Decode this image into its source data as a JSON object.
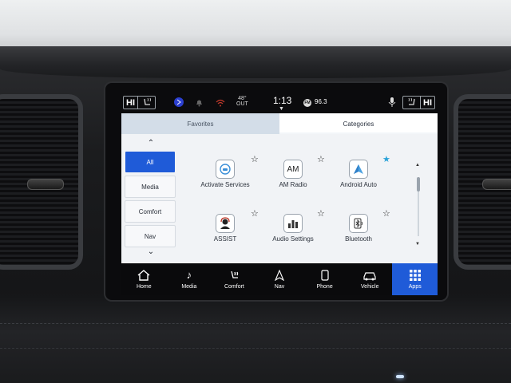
{
  "status_bar": {
    "driver_temp": "HI",
    "passenger_temp": "HI",
    "outside_temp": "48°",
    "outside_label": "OUT",
    "time": "1:13",
    "radio_band": "FM",
    "radio_frequency": "96.3",
    "icons": [
      "heated-seat-icon",
      "sync-icon",
      "bell-icon",
      "wifi-icon",
      "microphone-icon"
    ]
  },
  "tabs": [
    {
      "label": "Favorites",
      "active": false
    },
    {
      "label": "Categories",
      "active": true
    }
  ],
  "categories": [
    {
      "label": "All",
      "selected": true
    },
    {
      "label": "Media",
      "selected": false
    },
    {
      "label": "Comfort",
      "selected": false
    },
    {
      "label": "Nav",
      "selected": false
    }
  ],
  "apps": [
    {
      "label": "Activate Services",
      "icon": "car-service-icon",
      "favorite": false
    },
    {
      "label": "AM Radio",
      "icon": "am-radio-icon",
      "icon_text": "AM",
      "favorite": false
    },
    {
      "label": "Android Auto",
      "icon": "android-auto-icon",
      "favorite": true
    },
    {
      "label": "ASSIST",
      "icon": "assist-icon",
      "favorite": false
    },
    {
      "label": "Audio Settings",
      "icon": "audio-settings-icon",
      "favorite": false
    },
    {
      "label": "Bluetooth",
      "icon": "bluetooth-icon",
      "favorite": false
    }
  ],
  "bottom_nav": [
    {
      "label": "Home",
      "icon": "home-icon",
      "active": false
    },
    {
      "label": "Media",
      "icon": "music-note-icon",
      "active": false
    },
    {
      "label": "Comfort",
      "icon": "comfort-icon",
      "active": false
    },
    {
      "label": "Nav",
      "icon": "navigation-icon",
      "active": false
    },
    {
      "label": "Phone",
      "icon": "phone-icon",
      "active": false
    },
    {
      "label": "Vehicle",
      "icon": "vehicle-icon",
      "active": false
    },
    {
      "label": "Apps",
      "icon": "apps-grid-icon",
      "active": true
    }
  ],
  "colors": {
    "accent": "#1f5bd8",
    "favorite_star": "#2aa2d8"
  }
}
